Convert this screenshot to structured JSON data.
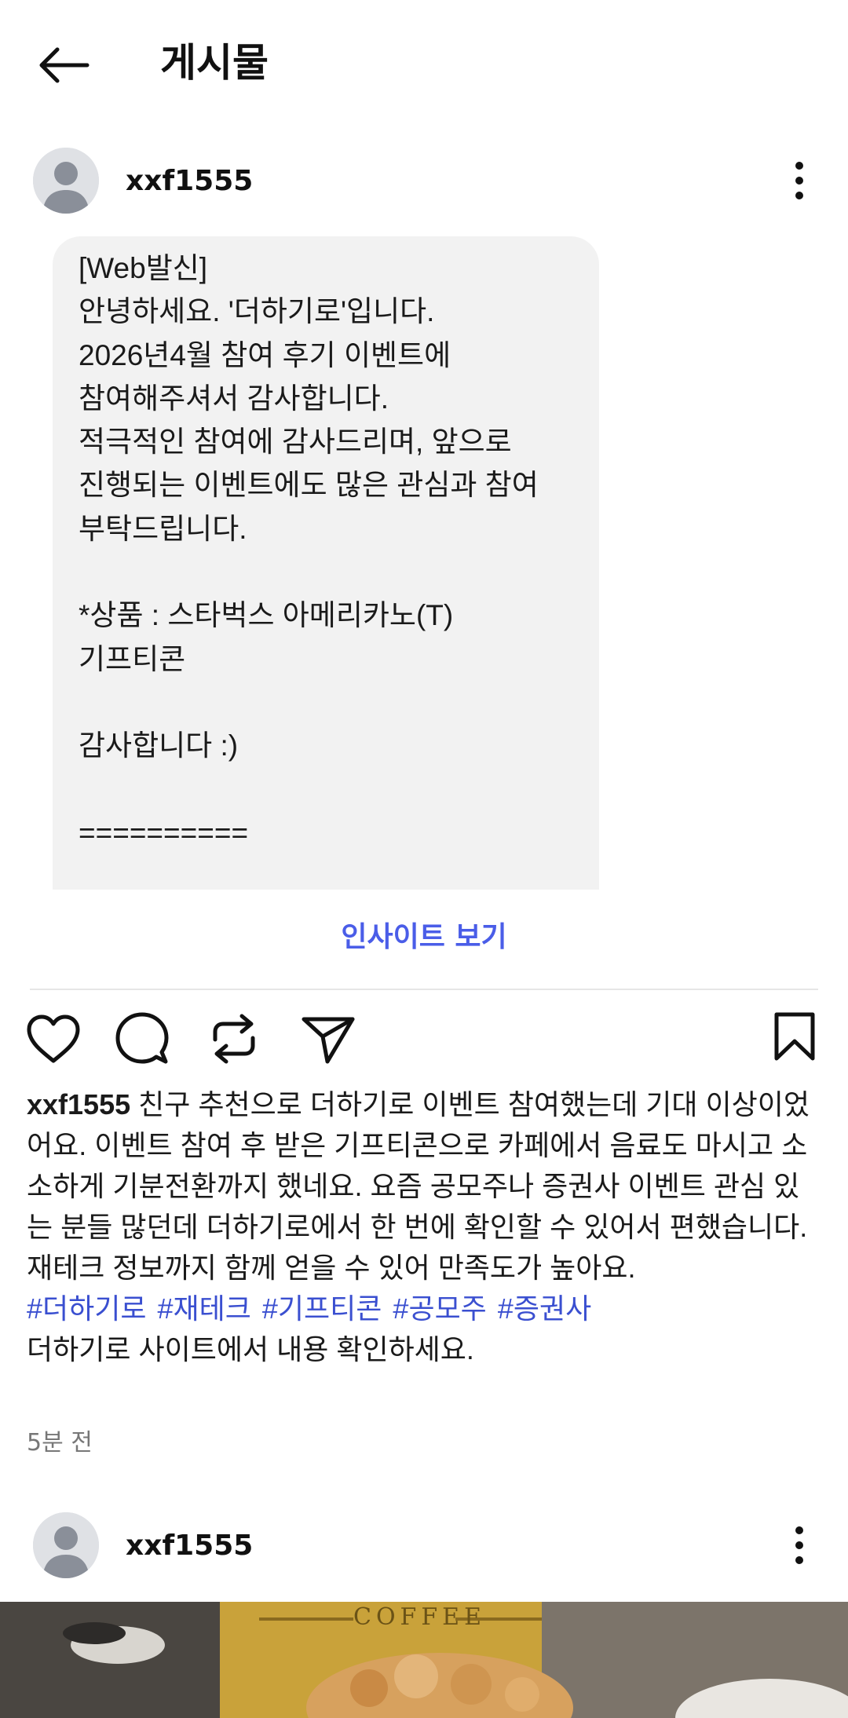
{
  "header": {
    "title": "게시물"
  },
  "post": {
    "username": "xxf1555",
    "message_lines": [
      "[Web발신]",
      "안녕하세요. '더하기로'입니다.",
      "2026년4월 참여 후기 이벤트에",
      "참여해주셔서 감사합니다.",
      "적극적인 참여에 감사드리며, 앞으로",
      "진행되는 이벤트에도 많은 관심과 참여",
      "부탁드립니다.",
      "",
      "*상품 : 스타벅스 아메리카노(T)",
      "기프티콘",
      "",
      "감사합니다 :)",
      "",
      "=========="
    ],
    "insights_label": "인사이트 보기",
    "caption_user": "xxf1555",
    "caption_text": "친구 추천으로 더하기로 이벤트 참여했는데 기대 이상이었어요. 이벤트 참여 후 받은 기프티콘으로 카페에서 음료도 마시고 소소하게 기분전환까지 했네요. 요즘 공모주나 증권사 이벤트 관심 있는 분들 많던데 더하기로에서 한 번에 확인할 수 있어서 편했습니다. 재테크 정보까지 함께 얻을 수 있어 만족도가 높아요.",
    "hashtags": [
      "#더하기로",
      "#재테크",
      "#기프티콘",
      "#공모주",
      "#증권사"
    ],
    "footer_text": "더하기로 사이트에서 내용 확인하세요.",
    "time_ago": "5분 전"
  },
  "post2": {
    "username": "xxf1555",
    "image_text": "COFFEE"
  },
  "colors": {
    "link": "#4a5de8",
    "hashtag": "#3a4fd0",
    "bubble": "#f2f2f2"
  }
}
